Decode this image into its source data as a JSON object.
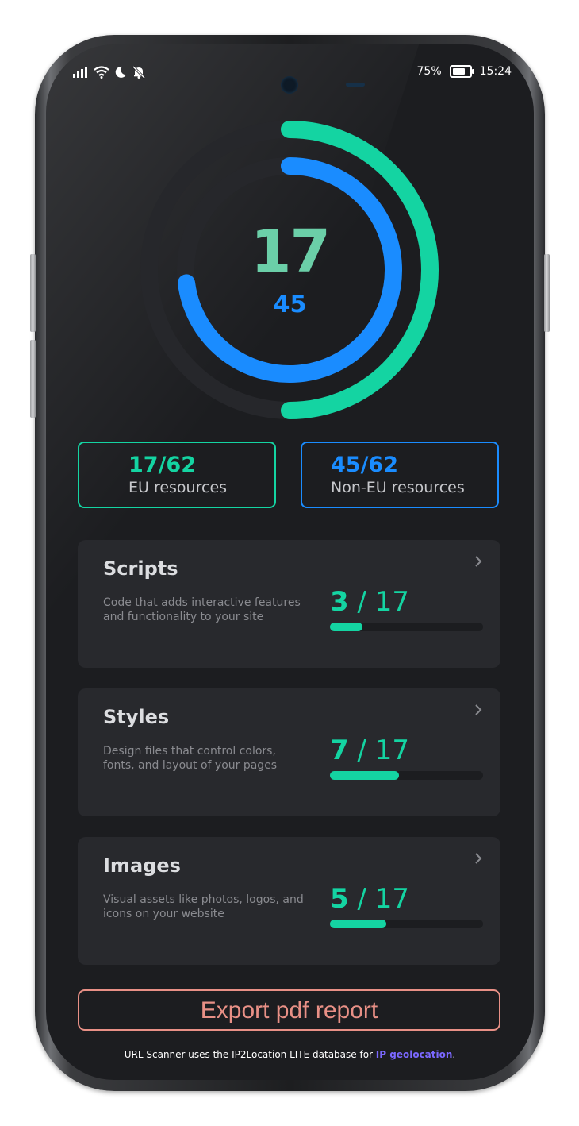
{
  "status_bar": {
    "icons": [
      "signal-icon",
      "wifi-icon",
      "moon-icon",
      "bell-off-icon"
    ],
    "battery_percent": "75%",
    "battery_level": 0.75,
    "time": "15:24"
  },
  "gauge": {
    "eu_count": "17",
    "non_eu_count": "45",
    "total": 62,
    "eu_value": 17,
    "non_eu_value": 45,
    "eu_color": "#14d4a2",
    "non_eu_color": "#1a8cff"
  },
  "summary": {
    "eu": {
      "value": "17/62",
      "label": "EU resources",
      "color": "#14d4a2"
    },
    "non_eu": {
      "value": "45/62",
      "label": "Non-EU resources",
      "color": "#1a8cff"
    }
  },
  "categories": [
    {
      "title": "Scripts",
      "description": "Code that adds interactive features and functionality to your site",
      "count": "3",
      "separator": "/",
      "total": "17",
      "progress": 0.21
    },
    {
      "title": "Styles",
      "description": "Design files that control colors, fonts, and layout of your pages",
      "count": "7",
      "separator": "/",
      "total": "17",
      "progress": 0.45
    },
    {
      "title": "Images",
      "description": "Visual assets like photos, logos, and icons on your website",
      "count": "5",
      "separator": "/",
      "total": "17",
      "progress": 0.37
    }
  ],
  "export_button": {
    "label": "Export pdf report",
    "color": "#e89086"
  },
  "footer": {
    "text": "URL Scanner uses the IP2Location LITE database for ",
    "link": "IP geolocation",
    "end": "."
  }
}
